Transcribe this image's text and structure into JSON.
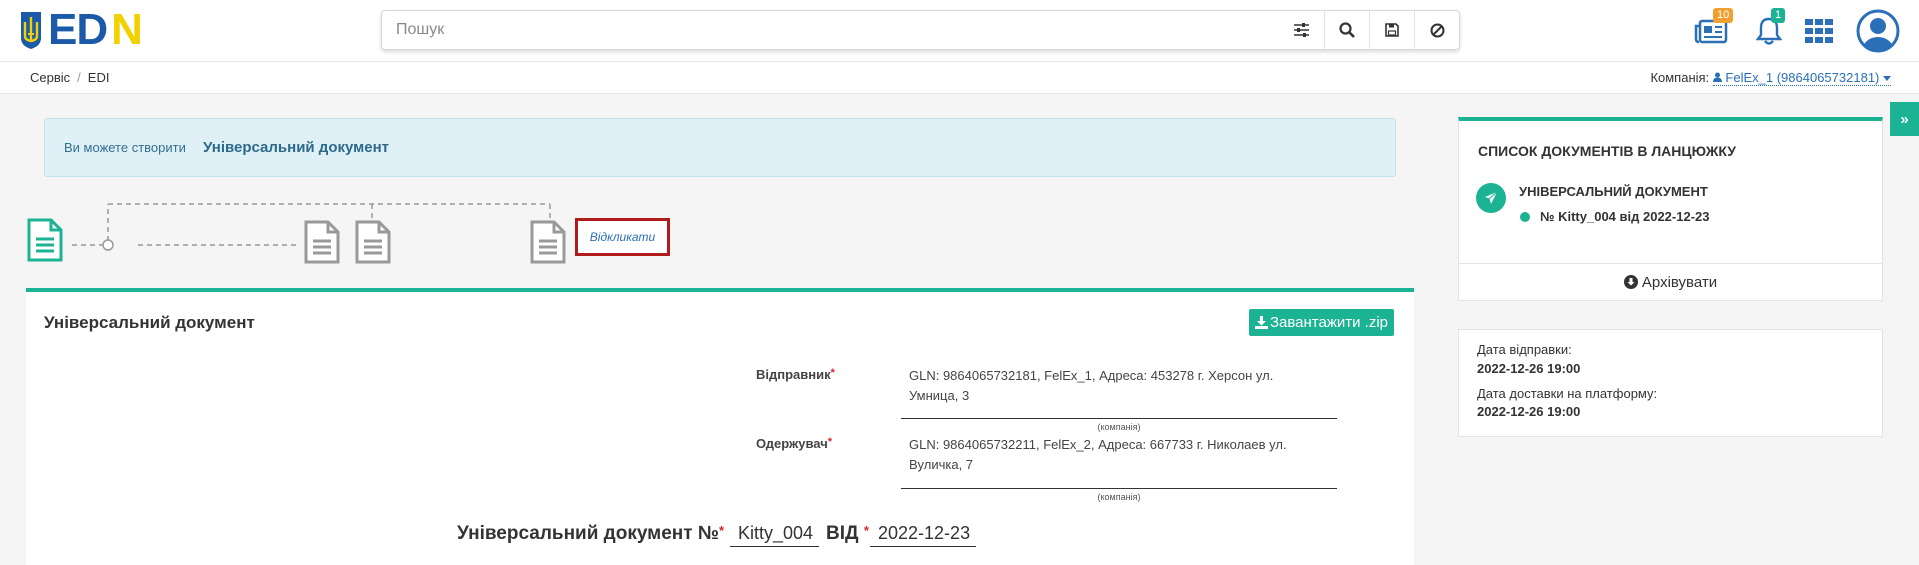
{
  "header": {
    "logo_text_blue": "ED",
    "logo_text_yellow": "N",
    "search_placeholder": "Пошук",
    "news_badge": "10",
    "notifications_badge": "1"
  },
  "breadcrumb": {
    "items": [
      "Сервіс",
      "EDI"
    ],
    "company_label": "Компанія:",
    "company_value": "FelEx_1 (9864065732181)"
  },
  "alert": {
    "prefix": "Ви можете створити",
    "document": "Універсальний документ"
  },
  "chain": {
    "recall_label": "Відкликати"
  },
  "panel": {
    "title": "Універсальний документ",
    "download_label": "Завантажити .zip",
    "sender_label": "Відправник",
    "sender_line1": "GLN: 9864065732181, FelEx_1, Адреса: 453278 г. Херсон ул.",
    "sender_line2": "Умница, 3",
    "sender_hint": "(компанія)",
    "receiver_label": "Одержувач",
    "receiver_line1": "GLN: 9864065732211, FelEx_2, Адреса: 667733 г. Николаев ул.",
    "receiver_line2": "Вуличка, 7",
    "receiver_hint": "(компанія)",
    "doc_title": "Універсальний документ №",
    "doc_number": "Kitty_004",
    "from_label": "ВІД",
    "doc_date": "2022-12-23"
  },
  "sidebar": {
    "chain_title": "СПИСОК ДОКУМЕНТІВ В ЛАНЦЮЖКУ",
    "chain_doc_name": "УНІВЕРСАЛЬНИЙ ДОКУМЕНТ",
    "chain_doc_number": "№ Kitty_004 від 2022-12-23",
    "archive_label": "Архівувати",
    "sent_label": "Дата відправки:",
    "sent_value": "2022-12-26 19:00",
    "delivered_label": "Дата доставки на платформу:",
    "delivered_value": "2022-12-26 19:00"
  },
  "colors": {
    "accent": "#1bb394",
    "brand_blue": "#1a5aa8",
    "brand_yellow": "#f3d100",
    "link": "#2a6fb8",
    "highlight": "#b01c1c"
  },
  "icons": [
    "trident-logo",
    "filter-sliders-icon",
    "search-icon",
    "save-icon",
    "clear-icon",
    "news-icon",
    "bell-icon",
    "apps-grid-icon",
    "user-avatar-icon",
    "chevron-right-double-icon",
    "document-icon",
    "paper-plane-icon",
    "download-icon",
    "archive-icon"
  ]
}
